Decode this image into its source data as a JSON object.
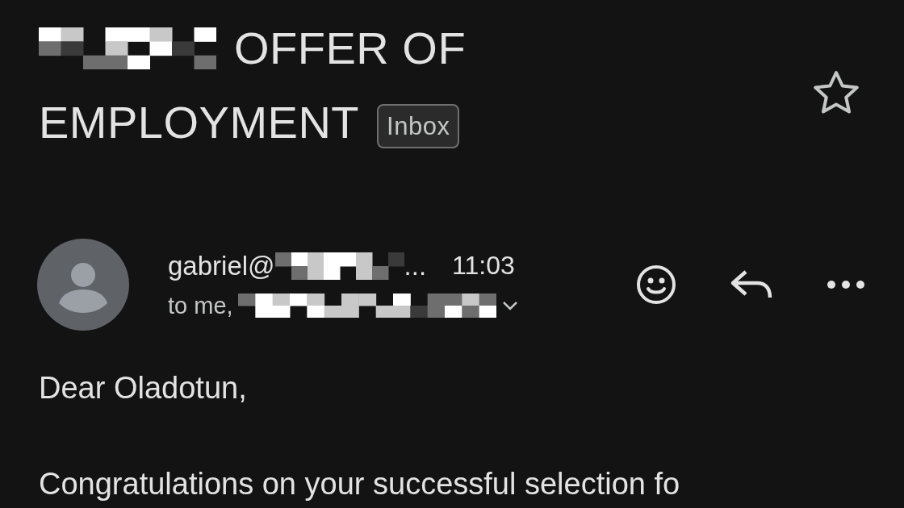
{
  "email": {
    "subject_line_1": "OFFER OF",
    "subject_line_2": "EMPLOYMENT",
    "label": "Inbox",
    "starred": false,
    "sender": {
      "name": "gabriel@",
      "ellipsis": "...",
      "time": "11:03",
      "recipients": "to me,"
    },
    "body": [
      "Dear Oladotun,",
      "Congratulations on your successful selection fo"
    ]
  }
}
